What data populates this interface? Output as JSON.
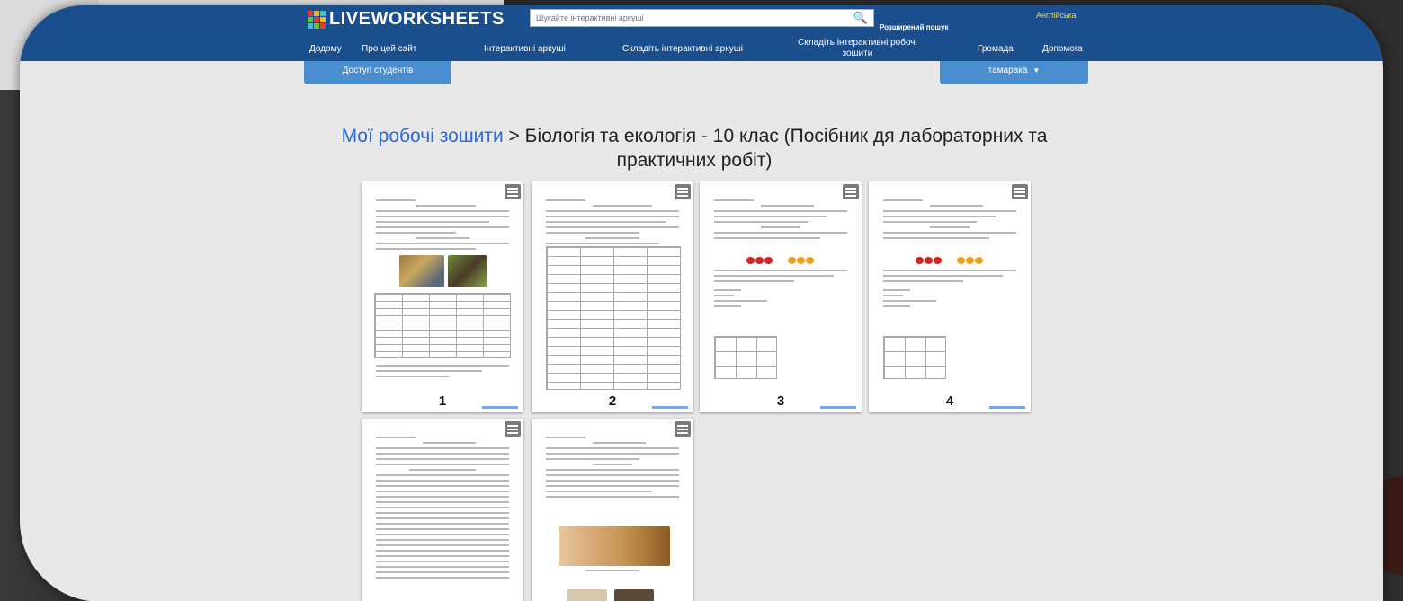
{
  "header": {
    "logo": "LIVEWORKSHEETS",
    "search_placeholder": "Шукайте інтерактивні аркуші",
    "advanced_search": "Розширений пошук",
    "language": "Англійська"
  },
  "nav": {
    "home": "Додому",
    "about": "Про цей сайт",
    "interactive": "Інтерактивні аркуші",
    "make_interactive": "Складіть інтерактивні аркуші",
    "make_workbooks_l1": "Складіть інтерактивні робочі",
    "make_workbooks_l2": "зошити",
    "community": "Громада",
    "help": "Допомога"
  },
  "tabs": {
    "student_access": "Доступ студентів",
    "teacher": "тамарака"
  },
  "breadcrumb": {
    "link": "Мої робочі зошити",
    "separator": ">",
    "current": "Біологія та екологія - 10 клас (Посібник дя лабораторних та практичних робіт)"
  },
  "worksheets": [
    {
      "number": "1"
    },
    {
      "number": "2"
    },
    {
      "number": "3"
    },
    {
      "number": "4"
    },
    {
      "number": ""
    },
    {
      "number": ""
    }
  ],
  "colors": {
    "topbar": "#1b4e8c",
    "tab": "#4a8ed0",
    "link": "#2a68d6",
    "language": "#f1d84a"
  },
  "icons": {
    "menu": "hamburger-menu-icon",
    "search": "magnifier-icon"
  }
}
